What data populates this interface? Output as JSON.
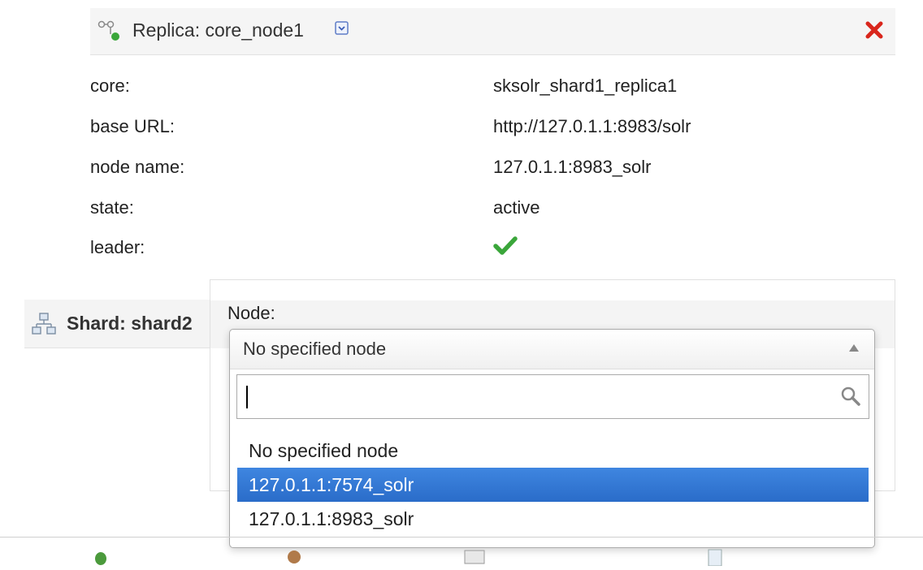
{
  "replica": {
    "title": "Replica: core_node1",
    "icon": "replica-node-icon",
    "dropdown_icon": "expand-dropdown-icon",
    "delete_icon": "delete-x-icon",
    "properties": [
      {
        "label": "core:",
        "value": "sksolr_shard1_replica1"
      },
      {
        "label": "base URL:",
        "value": "http://127.0.1.1:8983/solr"
      },
      {
        "label": "node name:",
        "value": "127.0.1.1:8983_solr"
      },
      {
        "label": "state:",
        "value": "active"
      },
      {
        "label": "leader:",
        "value": ""
      }
    ],
    "leader_icon": "checkmark-icon"
  },
  "shard": {
    "title": "Shard: shard2",
    "icon": "shard-tree-icon"
  },
  "add_replica_form": {
    "node_label": "Node:",
    "select": {
      "selected": "No specified node",
      "search_value": "",
      "options": [
        {
          "label": "No specified node",
          "highlighted": false
        },
        {
          "label": "127.0.1.1:7574_solr",
          "highlighted": true
        },
        {
          "label": "127.0.1.1:8983_solr",
          "highlighted": false
        }
      ]
    }
  },
  "colors": {
    "highlight": "#2f74d6",
    "delete": "#d9261c",
    "check": "#3aa63a"
  }
}
